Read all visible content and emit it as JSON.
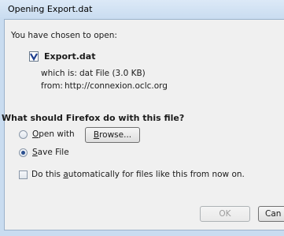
{
  "window": {
    "title": "Opening Export.dat"
  },
  "dialog": {
    "intro": "You have chosen to open:",
    "file_name": "Export.dat",
    "which_is_label": "which is:",
    "which_is_value": "dat File (3.0 KB)",
    "from_label": "from:",
    "from_value": "http://connexion.oclc.org",
    "question": "What should Firefox do with this file?",
    "open_with": {
      "access_key": "O",
      "rest": "pen with",
      "selected": false
    },
    "browse_label": "Browse...",
    "save_file": {
      "access_key": "S",
      "rest": "ave File",
      "selected": true
    },
    "auto_checkbox": {
      "before": "Do this ",
      "access_key": "a",
      "after": "utomatically for files like this from now on.",
      "checked": false
    },
    "ok_label": "OK",
    "cancel_label": "Can"
  }
}
